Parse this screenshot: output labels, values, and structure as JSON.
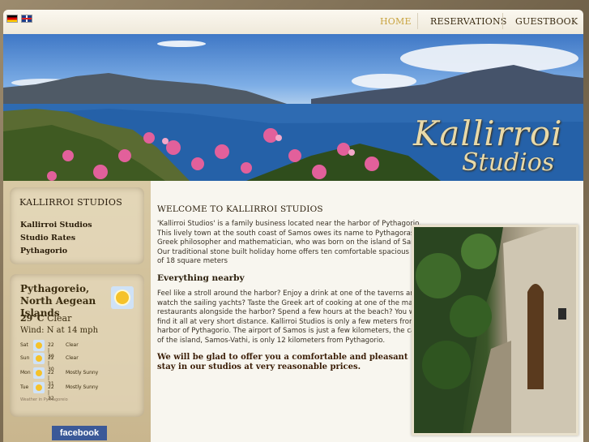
{
  "flags": [
    {
      "lang": "German",
      "icon": "german-flag-icon"
    },
    {
      "lang": "English",
      "icon": "uk-flag-icon"
    }
  ],
  "nav": {
    "home": "HOME",
    "reservations": "RESERVATIONS",
    "guestbook": "GUESTBOOK"
  },
  "colors": {
    "nav_active": "#c9a440",
    "accent_text": "#3a1d06",
    "facebook": "#3b5998"
  },
  "banner": {
    "logo_line1": "Kallirroi",
    "logo_line2": "Studios"
  },
  "sidebar": {
    "title": "KALLIRROI STUDIOS",
    "links": [
      "Kallirroi Studios",
      "Studio Rates",
      "Pythagorio"
    ]
  },
  "weather": {
    "location": "Pythagoreio, North Aegean Islands",
    "temp": "29°C",
    "cond": "Clear",
    "wind": "Wind: N at 14 mph",
    "icon": "sun-icon",
    "forecast": [
      {
        "day": "Sat",
        "temps": "22 | 30",
        "cond": "Clear"
      },
      {
        "day": "Sun",
        "temps": "22 | 30",
        "cond": "Clear"
      },
      {
        "day": "Mon",
        "temps": "22 | 31",
        "cond": "Mostly Sunny"
      },
      {
        "day": "Tue",
        "temps": "22 | 32",
        "cond": "Mostly Sunny"
      }
    ],
    "credit": "Weather in Pythagoreio"
  },
  "facebook_label": "facebook",
  "content": {
    "heading": "WELCOME TO KALLIRROI STUDIOS",
    "intro": [
      "'Kallirroi Studios' is a family business located near the harbor of Pythagorio.",
      "This lively town at the south coast of Samos owes its name to Pythagoras, the",
      "Greek philosopher and mathematician, who was born on the island of Samos.",
      "Our traditional stone built holiday home offers ten comfortable spacious studios",
      "of 18 square meters"
    ],
    "subheading": "Everything nearby",
    "body": [
      "Feel like a stroll around the harbor? Enjoy a drink at one of the taverns and",
      "watch the sailing yachts? Taste the Greek art of cooking at one of the many",
      "restaurants alongside the harbor? Spend a few hours at the beach? You will",
      "find it all at very short distance. Kallirroi Studios is only a few meters from the",
      "harbor of Pythagorio. The airport of Samos is just a few kilometers, the capital",
      "of the island, Samos-Vathi, is only 12 kilometers from Pythagorio."
    ],
    "closing": "We will be glad to offer you a comfortable and pleasant stay in our studios at very reasonable prices."
  }
}
